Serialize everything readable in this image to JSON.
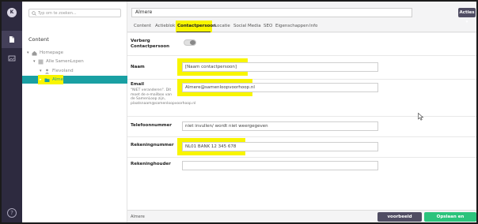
{
  "rail": {
    "avatar_letter": "K",
    "items": [
      {
        "icon": "document-icon"
      },
      {
        "icon": "image-icon"
      }
    ],
    "help_label": "?"
  },
  "tree": {
    "search_placeholder": "Typ om te zoeken...",
    "title": "Content",
    "nodes": [
      {
        "label": "Homepage",
        "toggle": "▾"
      },
      {
        "label": "Alle SamenLopen",
        "toggle": "▾"
      },
      {
        "label": "Flevoland",
        "toggle": "▾"
      },
      {
        "label": "Almere",
        "toggle": "▸"
      }
    ]
  },
  "header": {
    "name_value": "Almere",
    "actions_label": "Acties ▾"
  },
  "tabs": [
    "Content",
    "Actieblok",
    "Contactpersoon",
    "Locatie",
    "Social Media",
    "SEO",
    "Eigenschappen",
    "Info"
  ],
  "form": {
    "hide_label": "Verberg Contactpersoon",
    "name_label": "Naam",
    "name_value": "[Naam contactpersoon]",
    "email_label": "Email",
    "email_desc": "\"NIET veranderen\". Dit moet de e-mailbox van de SamenLoop zijn, plaatsnaam@samenloopvoorhoop.nl",
    "email_value": "Almere@samenloopvoorhoop.nl",
    "phone_label": "Telefoonnummer",
    "phone_value": "niet invullen/ wordt niet weergegeven",
    "account_label": "Rekeningnummer",
    "account_value": "NL01 BANK 12 345 678",
    "holder_label": "Rekeninghouder",
    "holder_value": ""
  },
  "footer": {
    "breadcrumb": "Almere",
    "preview_label": "voorbeeld bekijken",
    "save_label": "Opslaan en publiceren ▴"
  },
  "colors": {
    "rail": "#2d2a3f",
    "selected_node": "#19a0a3",
    "highlight": "#f8f500",
    "save_button": "#2bc37c",
    "preview_button": "#504d63"
  }
}
